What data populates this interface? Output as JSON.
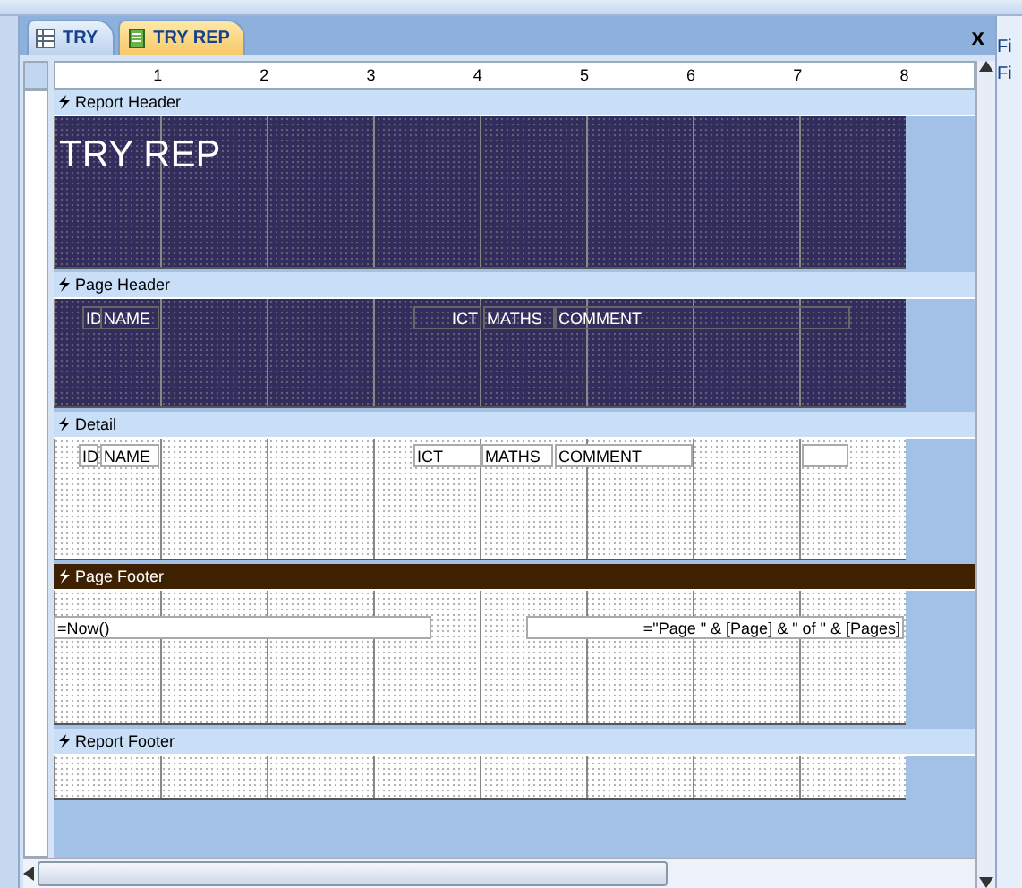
{
  "tabs": [
    {
      "label": "TRY",
      "kind": "table",
      "selected": false
    },
    {
      "label": "TRY REP",
      "kind": "report",
      "selected": true
    }
  ],
  "close": "x",
  "side_panel": [
    "Fi",
    "Fi"
  ],
  "ruler": [
    "1",
    "2",
    "3",
    "4",
    "5",
    "6",
    "7",
    "8"
  ],
  "sections": [
    {
      "title": "Report Header",
      "selected": false,
      "color": "#332d5e",
      "controls": [
        {
          "kind": "title",
          "text": "TRY REP"
        }
      ]
    },
    {
      "title": "Page Header",
      "selected": false,
      "color": "#332d5e",
      "controls": [
        {
          "kind": "label",
          "text": "ID"
        },
        {
          "kind": "label",
          "text": "NAME"
        },
        {
          "kind": "label",
          "text": "ICT"
        },
        {
          "kind": "label",
          "text": "MATHS"
        },
        {
          "kind": "label",
          "text": "COMMENT"
        }
      ]
    },
    {
      "title": "Detail",
      "selected": false,
      "color": "#ffffff",
      "controls": [
        {
          "kind": "textbox",
          "text": "ID"
        },
        {
          "kind": "textbox",
          "text": "NAME"
        },
        {
          "kind": "textbox",
          "text": "ICT"
        },
        {
          "kind": "textbox",
          "text": "MATHS"
        },
        {
          "kind": "textbox",
          "text": "COMMENT"
        },
        {
          "kind": "textbox"
        }
      ]
    },
    {
      "title": "Page Footer",
      "selected": true,
      "color": "#ffffff",
      "controls": [
        {
          "kind": "textbox",
          "text": "=Now()"
        },
        {
          "kind": "textbox",
          "text": "=\"Page \" & [Page] & \" of \" & [Pages]"
        }
      ]
    },
    {
      "title": "Report Footer",
      "selected": false,
      "color": "#ffffff"
    }
  ]
}
